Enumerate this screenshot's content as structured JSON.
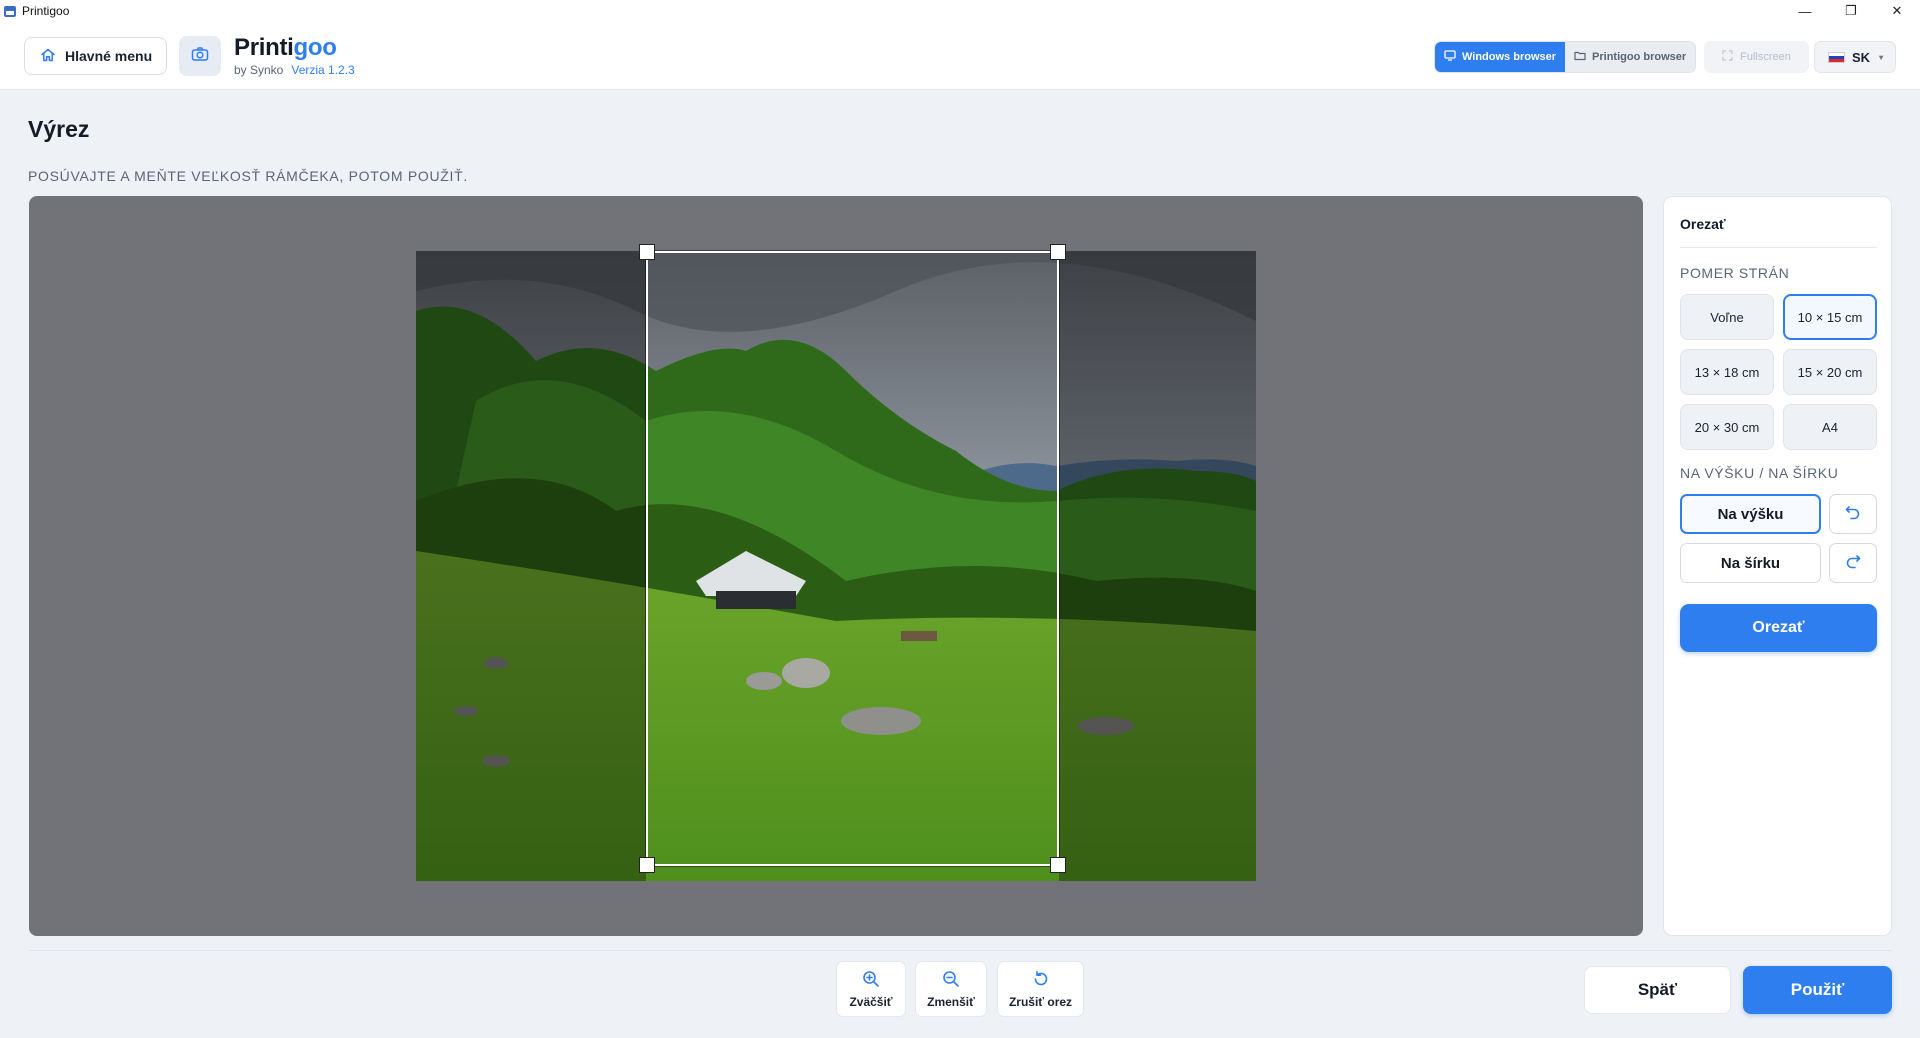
{
  "window": {
    "title": "Printigoo",
    "controls": {
      "minimize": "—",
      "restore": "❐",
      "close": "✕"
    }
  },
  "header": {
    "home_label": "Hlavné menu",
    "brand_main": "Printi",
    "brand_accent": "goo",
    "brand_by": "by Synko",
    "version": "Verzia 1.2.3",
    "browser_windows": "Windows browser",
    "browser_printigoo": "Printigoo browser",
    "fullscreen": "Fullscreen",
    "language": "SK",
    "language_caret": "▾",
    "icons": [
      "home-icon",
      "camera-icon",
      "monitor-icon",
      "folder-icon",
      "fullscreen-icon"
    ]
  },
  "page": {
    "title": "Výrez",
    "hint": "POSÚVAJTE A MEŇTE VEĽKOSŤ RÁMČEKA, POTOM POUŽIŤ."
  },
  "panel": {
    "title": "Orezať",
    "ratio_label": "POMER STRÁN",
    "ratios": [
      {
        "label": "Voľne",
        "selected": false
      },
      {
        "label": "10 × 15 cm",
        "selected": true
      },
      {
        "label": "13 × 18 cm",
        "selected": false
      },
      {
        "label": "15 × 20 cm",
        "selected": false
      },
      {
        "label": "20 × 30 cm",
        "selected": false
      },
      {
        "label": "A4",
        "selected": false
      }
    ],
    "orientation_label": "NA VÝŠKU / NA ŠÍRKU",
    "portrait": "Na výšku",
    "landscape": "Na šírku",
    "crop_button": "Orezať"
  },
  "toolbar": {
    "zoom_in": "Zväčšiť",
    "zoom_out": "Zmenšiť",
    "reset": "Zrušiť orez"
  },
  "actions": {
    "back": "Späť",
    "apply": "Použiť"
  },
  "colors": {
    "accent": "#2f7ef0",
    "canvas": "#727378",
    "background": "#eef1f6"
  }
}
